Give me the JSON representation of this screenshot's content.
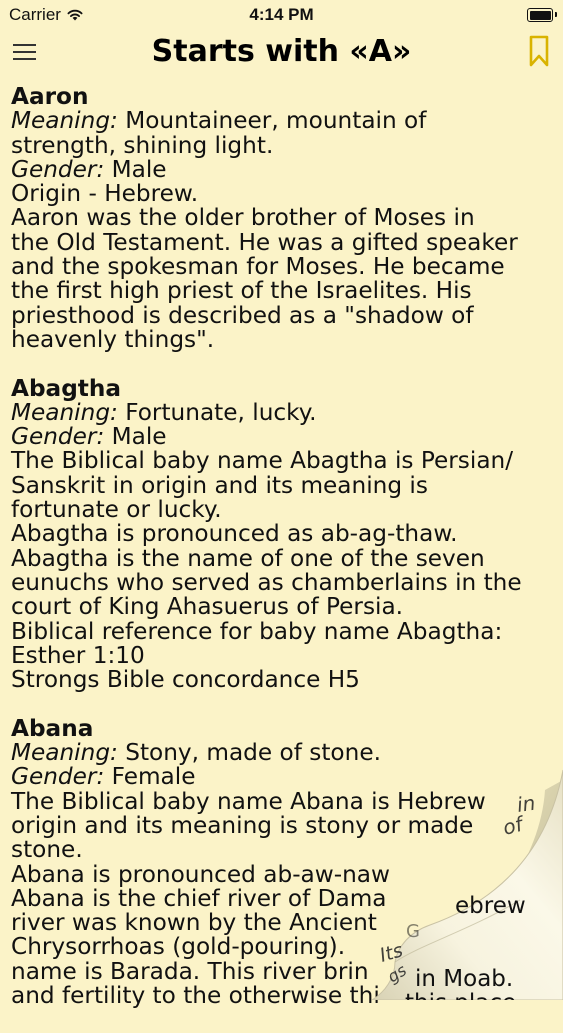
{
  "status_bar": {
    "carrier": "Carrier",
    "time": "4:14 PM"
  },
  "nav": {
    "title": "Starts with «A»",
    "menu_icon": "hamburger-menu-icon",
    "bookmark_icon": "bookmark-icon"
  },
  "colors": {
    "background": "#fbf3c8",
    "bookmark": "#d9b300",
    "text": "#111111"
  },
  "entries": [
    {
      "name": "Aaron",
      "meaning_label": "Meaning:",
      "meaning_lines": [
        " Mountaineer, mountain of",
        "strength, shining light."
      ],
      "gender_label": "Gender:",
      "gender_value": " Male",
      "body_lines": [
        "Origin - Hebrew.",
        "Aaron was the older brother of Moses in",
        "the Old Testament. He was a gifted speaker",
        "and the spokesman for Moses. He became",
        "the first high priest of the Israelites. His",
        "priesthood is described as a \"shadow of",
        "heavenly things\"."
      ]
    },
    {
      "name": "Abagtha",
      "meaning_label": "Meaning:",
      "meaning_lines": [
        " Fortunate, lucky."
      ],
      "gender_label": "Gender:",
      "gender_value": " Male",
      "body_lines": [
        "The Biblical baby name Abagtha is Persian/",
        "Sanskrit in origin and its meaning is",
        "fortunate or lucky.",
        "Abagtha is pronounced as ab-ag-thaw.",
        "Abagtha is the name of one of the seven",
        "eunuchs who served as chamberlains in the",
        "court of King Ahasuerus of Persia.",
        "Biblical reference for baby name Abagtha:",
        "Esther 1:10",
        "Strongs Bible concordance H5"
      ]
    },
    {
      "name": "Abana",
      "meaning_label": "Meaning:",
      "meaning_lines": [
        " Stony, made of stone."
      ],
      "gender_label": "Gender:",
      "gender_value": " Female",
      "body_lines": [
        "The Biblical baby name Abana is Hebrew",
        "origin and its meaning is stony or made",
        "stone.",
        "Abana is pronounced ab-aw-naw",
        "Abana is the chief river of Dama",
        "river was known by the Ancient",
        "Chrysorrhoas (gold-pouring).",
        "name is Barada. This river brin",
        "and fertility to the otherwise thi"
      ]
    }
  ],
  "curl_text": [
    "in",
    "of",
    "ebrew",
    "Its",
    "gs",
    "in Moab.",
    "G",
    "this place"
  ]
}
